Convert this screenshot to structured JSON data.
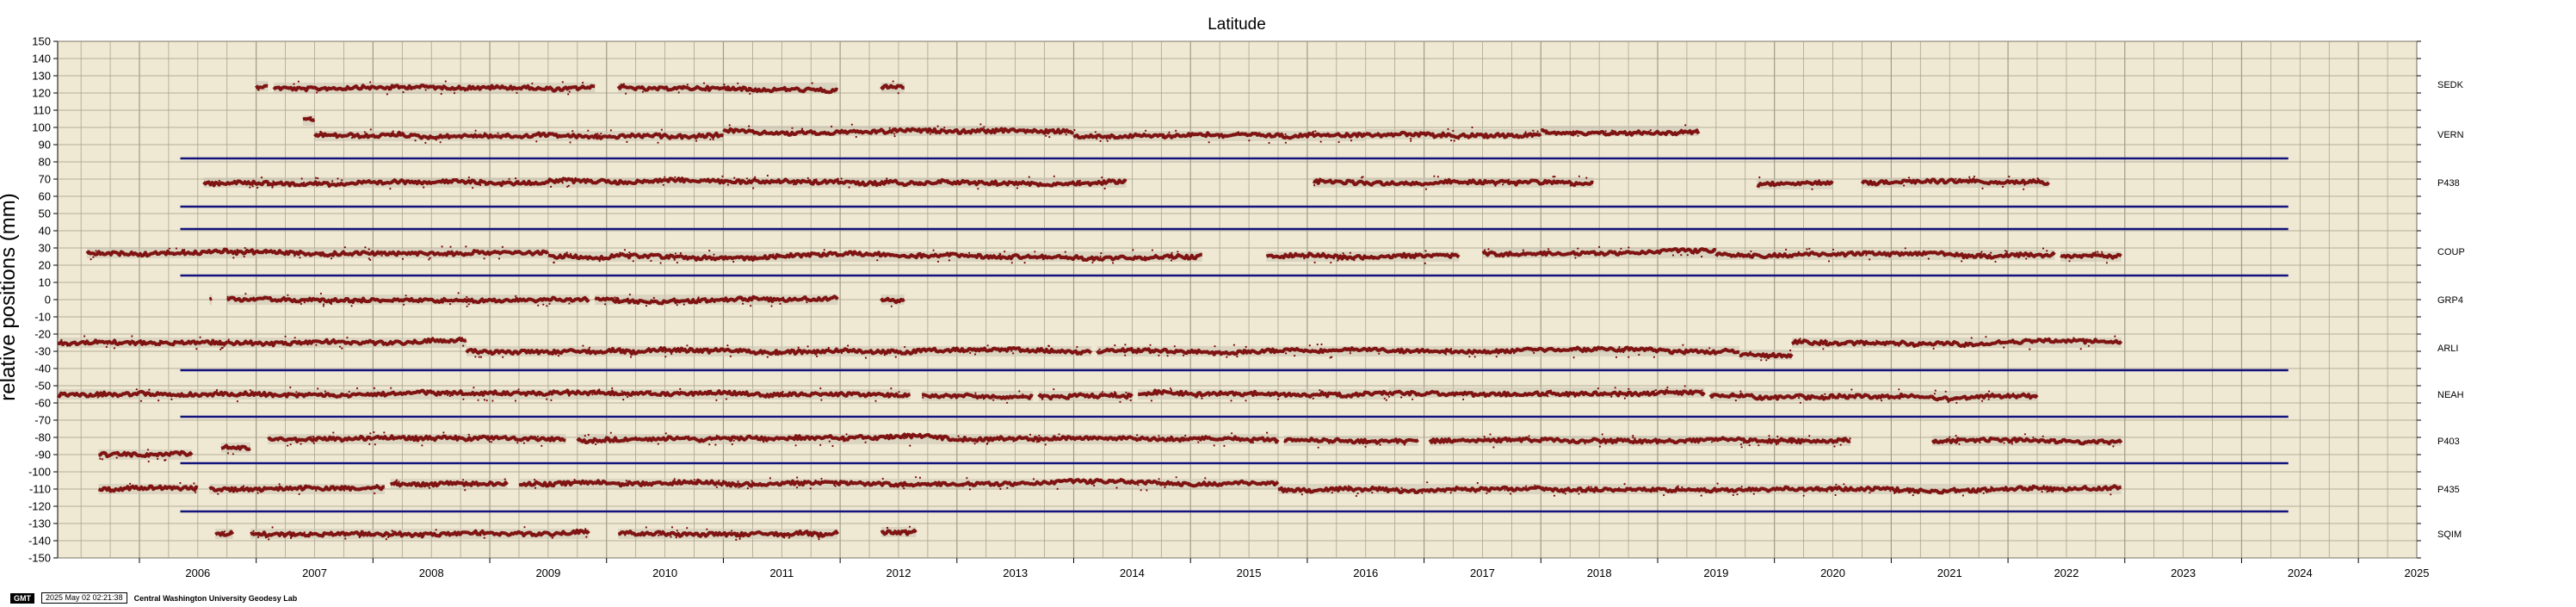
{
  "chart_data": {
    "type": "scatter",
    "title": "Latitude",
    "ylabel": "relative positions (mm)",
    "xlabel": "",
    "ylim": [
      -150,
      150
    ],
    "y_ticks": [
      150,
      140,
      130,
      120,
      110,
      100,
      90,
      80,
      70,
      60,
      50,
      40,
      30,
      20,
      10,
      0,
      -10,
      -20,
      -30,
      -40,
      -50,
      -60,
      -70,
      -80,
      -90,
      -100,
      -110,
      -120,
      -130,
      -140,
      -150
    ],
    "xlim": [
      2005.3,
      2025.5
    ],
    "x_tick_labels": [
      "2006",
      "2007",
      "2008",
      "2009",
      "2010",
      "2011",
      "2012",
      "2013",
      "2014",
      "2015",
      "2016",
      "2017",
      "2018",
      "2019",
      "2020",
      "2021",
      "2022",
      "2023",
      "2024",
      "2025"
    ],
    "grid": true,
    "stations": [
      {
        "name": "SEDK",
        "label_y": 125,
        "data_color": "#7a0a0a",
        "segments": [
          [
            2007.0,
            2007.1,
            124
          ],
          [
            2007.15,
            2009.9,
            123
          ],
          [
            2010.1,
            2011.98,
            123
          ],
          [
            2012.35,
            2012.55,
            123
          ]
        ]
      },
      {
        "name": "VERN",
        "label_y": 96,
        "data_color": "#7a0a0a",
        "segments": [
          [
            2007.4,
            2007.5,
            104
          ],
          [
            2007.5,
            2011.0,
            95
          ],
          [
            2011.0,
            2014.0,
            98
          ],
          [
            2014.0,
            2016.5,
            95
          ],
          [
            2016.5,
            2018.0,
            96
          ],
          [
            2018.0,
            2019.35,
            98
          ]
        ]
      },
      {
        "name": "P438",
        "label_y": 68,
        "data_color": "#7a0a0a",
        "segments": [
          [
            2006.55,
            2014.45,
            68
          ],
          [
            2016.05,
            2018.45,
            68
          ],
          [
            2019.85,
            2020.5,
            67
          ],
          [
            2020.75,
            2022.35,
            68
          ]
        ],
        "reference_lines": [
          82,
          54
        ]
      },
      {
        "name": "COUP",
        "label_y": 28,
        "data_color": "#7a0a0a",
        "segments": [
          [
            2005.55,
            2009.5,
            27
          ],
          [
            2009.5,
            2015.1,
            25
          ],
          [
            2015.65,
            2017.3,
            25
          ],
          [
            2017.5,
            2019.5,
            27
          ],
          [
            2019.5,
            2022.4,
            26
          ],
          [
            2022.45,
            2022.97,
            25
          ]
        ],
        "reference_lines": [
          41,
          14
        ]
      },
      {
        "name": "GRP4",
        "label_y": 0,
        "data_color": "#7a0a0a",
        "segments": [
          [
            2006.6,
            2006.62,
            0
          ],
          [
            2006.75,
            2009.85,
            0
          ],
          [
            2009.9,
            2011.98,
            0
          ],
          [
            2012.35,
            2012.55,
            0
          ]
        ]
      },
      {
        "name": "ARLI",
        "label_y": -28,
        "data_color": "#7a0a0a",
        "segments": [
          [
            2005.3,
            2008.8,
            -25
          ],
          [
            2008.8,
            2014.15,
            -30
          ],
          [
            2014.2,
            2019.7,
            -30
          ],
          [
            2019.7,
            2020.15,
            -32
          ],
          [
            2020.15,
            2022.97,
            -25
          ]
        ],
        "reference_lines": [
          -41
        ]
      },
      {
        "name": "NEAH",
        "label_y": -55,
        "data_color": "#7a0a0a",
        "segments": [
          [
            2005.3,
            2012.6,
            -55
          ],
          [
            2012.7,
            2013.65,
            -56
          ],
          [
            2013.7,
            2014.5,
            -56
          ],
          [
            2014.55,
            2016.7,
            -55
          ],
          [
            2016.7,
            2019.4,
            -54
          ],
          [
            2019.45,
            2022.25,
            -56
          ]
        ],
        "reference_lines": [
          -68
        ]
      },
      {
        "name": "P403",
        "label_y": -82,
        "data_color": "#7a0a0a",
        "segments": [
          [
            2005.65,
            2006.45,
            -90
          ],
          [
            2006.7,
            2006.95,
            -86
          ],
          [
            2007.1,
            2009.65,
            -81
          ],
          [
            2009.75,
            2015.75,
            -81
          ],
          [
            2015.8,
            2016.95,
            -82
          ],
          [
            2017.05,
            2020.65,
            -82
          ],
          [
            2021.35,
            2022.97,
            -82
          ]
        ],
        "reference_lines": [
          -95
        ]
      },
      {
        "name": "P435",
        "label_y": -110,
        "data_color": "#7a0a0a",
        "segments": [
          [
            2005.65,
            2006.5,
            -110
          ],
          [
            2006.6,
            2008.1,
            -110
          ],
          [
            2008.15,
            2009.15,
            -107
          ],
          [
            2009.25,
            2015.75,
            -107
          ],
          [
            2015.75,
            2018.0,
            -110
          ],
          [
            2018.0,
            2022.97,
            -110
          ]
        ],
        "reference_lines": [
          -123
        ]
      },
      {
        "name": "SQIM",
        "label_y": -136,
        "data_color": "#7a0a0a",
        "segments": [
          [
            2006.65,
            2006.8,
            -136
          ],
          [
            2006.95,
            2009.85,
            -136
          ],
          [
            2010.1,
            2011.98,
            -136
          ],
          [
            2012.35,
            2012.65,
            -135
          ]
        ]
      }
    ],
    "reference_line_span": [
      2006.35,
      2024.4
    ],
    "colors": {
      "background": "#efe8d2",
      "grid": "#a09c88",
      "data": "#7a0a0a",
      "reference": "#13137d",
      "error_band": "#c9c3b0"
    }
  },
  "footer": {
    "logo": "GMT",
    "timestamp": "2025 May 02 02:21:38",
    "lab": "Central Washington University Geodesy Lab"
  }
}
